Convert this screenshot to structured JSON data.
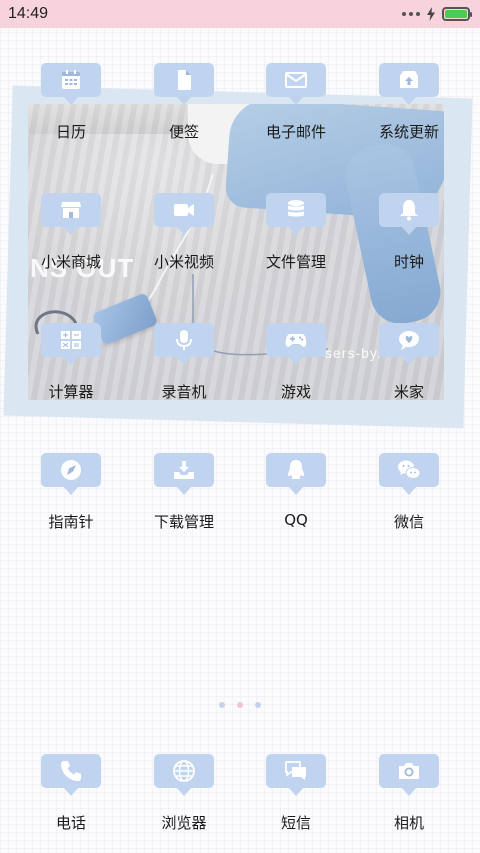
{
  "status_bar": {
    "time": "14:49",
    "battery_level": 1.0,
    "icons": [
      "more-dots-icon",
      "charging-bolt-icon",
      "battery-icon"
    ]
  },
  "wallpaper_widget": {
    "text_big": "NS OUT",
    "text_small": "sers-by."
  },
  "apps": [
    {
      "label": "日历",
      "icon": "calendar-icon"
    },
    {
      "label": "便签",
      "icon": "note-icon"
    },
    {
      "label": "电子邮件",
      "icon": "mail-icon"
    },
    {
      "label": "系统更新",
      "icon": "system-update-icon"
    },
    {
      "label": "小米商城",
      "icon": "store-icon"
    },
    {
      "label": "小米视频",
      "icon": "video-camera-icon"
    },
    {
      "label": "文件管理",
      "icon": "database-icon"
    },
    {
      "label": "时钟",
      "icon": "bell-icon"
    },
    {
      "label": "计算器",
      "icon": "calculator-icon"
    },
    {
      "label": "录音机",
      "icon": "microphone-icon"
    },
    {
      "label": "游戏",
      "icon": "gamepad-icon"
    },
    {
      "label": "米家",
      "icon": "heart-chat-icon"
    },
    {
      "label": "指南针",
      "icon": "compass-icon"
    },
    {
      "label": "下载管理",
      "icon": "download-icon"
    },
    {
      "label": "QQ",
      "icon": "penguin-icon"
    },
    {
      "label": "微信",
      "icon": "wechat-icon"
    }
  ],
  "page_indicator": {
    "count": 3,
    "active_index": 1
  },
  "dock": [
    {
      "label": "电话",
      "icon": "phone-icon"
    },
    {
      "label": "浏览器",
      "icon": "globe-icon"
    },
    {
      "label": "短信",
      "icon": "messages-icon"
    },
    {
      "label": "相机",
      "icon": "camera-icon"
    }
  ],
  "colors": {
    "status_bar_bg": "#f7d3de",
    "icon_bg": "#c0d4ef",
    "icon_glyph": "#ffffff",
    "page_dot": "#c5d3ea",
    "page_dot_active": "#f3c3d2",
    "battery_fill": "#4ccd4c"
  }
}
